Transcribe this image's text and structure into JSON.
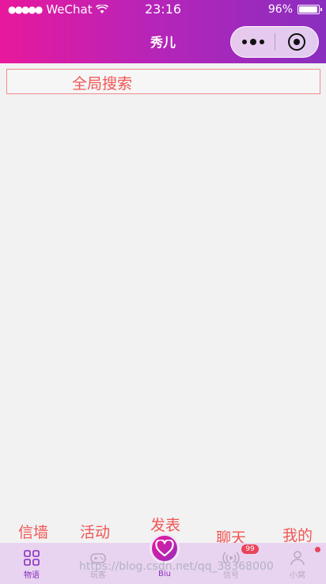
{
  "status_bar": {
    "signal_dots": "●●●●●",
    "carrier": "WeChat",
    "time": "23:16",
    "battery_text": "96%",
    "battery_level": 0.96
  },
  "nav": {
    "title": "秀儿"
  },
  "search": {
    "placeholder": "全局搜索"
  },
  "floating_labels": {
    "wall": "信墙",
    "activity": "活动",
    "post": "发表",
    "chat": "聊天",
    "mine": "我的"
  },
  "tabbar": {
    "items": [
      {
        "label": "物语",
        "icon": "grid-icon"
      },
      {
        "label": "玩客",
        "icon": "gamepad-icon"
      },
      {
        "label": "Biu",
        "icon": "heart-icon"
      },
      {
        "label": "信号",
        "icon": "signal-icon"
      },
      {
        "label": "小窝",
        "icon": "user-icon"
      }
    ],
    "badge": "99"
  },
  "watermark": "https://blog.csdn.net/qq_38368000",
  "colors": {
    "accent_pink": "#e8189c",
    "accent_purple": "#8a2ebf",
    "label_red": "#f25555",
    "tabbar_bg": "#e8d4f0"
  }
}
